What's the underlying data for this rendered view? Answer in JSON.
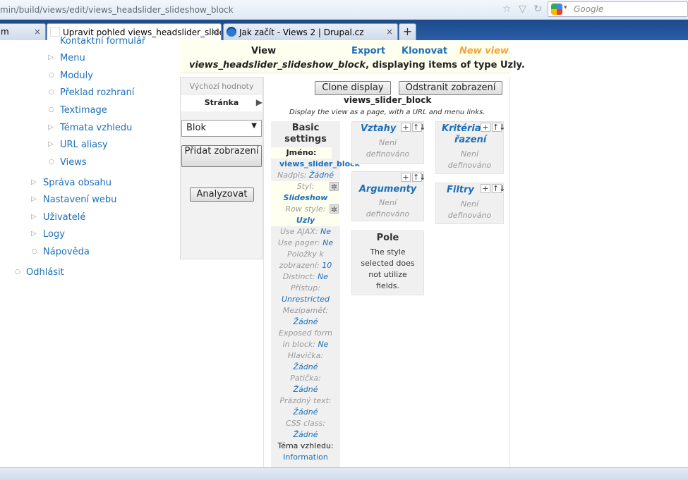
{
  "browser": {
    "url": "min/build/views/edit/views_headslider_slideshow_block",
    "search_placeholder": "Google",
    "tabs": [
      {
        "label": "m",
        "close": "×"
      },
      {
        "label": "Upravit pohled views_headslider_slide...",
        "close": "×"
      },
      {
        "label": "Jak začít - Views 2 | Drupal.cz",
        "close": "×"
      }
    ],
    "new_tab": "+"
  },
  "nav": {
    "sub_items": [
      "Kontaktní formulář",
      "Menu",
      "Moduly",
      "Překlad rozhraní",
      "Textimage",
      "Témata vzhledu",
      "URL aliasy",
      "Views"
    ],
    "top_items": [
      "Správa obsahu",
      "Nastavení webu",
      "Uživatelé",
      "Logy",
      "Nápověda"
    ],
    "logout": "Odhlásit"
  },
  "header": {
    "view_label": "View",
    "export": "Export",
    "clone": "Klonovat",
    "new_view": "New view",
    "view_name": "views_headslider_slideshow_block",
    "desc_suffix": ", displaying items of type Uzly."
  },
  "left": {
    "default_values": "Výchozí hodnoty",
    "active_tab": "Stránka",
    "select_value": "Blok",
    "add_display": "Přidat zobrazení",
    "analyze": "Analyzovat"
  },
  "display": {
    "clone_button": "Clone display",
    "remove_button": "Odstranit zobrazení",
    "name": "views_slider_block",
    "description": "Display the view as a page, with a URL and menu links."
  },
  "basic": {
    "heading": "Basic settings",
    "name_label": "Jméno:",
    "name_value": "views_slider_block",
    "title_label": "Nadpis:",
    "title_value": "Žádné",
    "style_label": "Styl:",
    "style_value": "Slideshow",
    "row_label": "Row style:",
    "row_value": "Uzly",
    "ajax_label": "Use AJAX:",
    "ajax_value": "Ne",
    "pager_label": "Use pager:",
    "pager_value": "Ne",
    "items_label_1": "Položky k",
    "items_label_2": "zobrazení:",
    "items_value": "10",
    "distinct_label": "Distinct:",
    "distinct_value": "Ne",
    "access_label": "Přístup:",
    "access_value": "Unrestricted",
    "cache_label": "Mezipaměť:",
    "cache_value": "Žádné",
    "exposed_label_1": "Exposed form",
    "exposed_label_2": "in block:",
    "exposed_value": "Ne",
    "header_label": "Hlavička:",
    "header_value": "Žádné",
    "footer_label": "Patička:",
    "footer_value": "Žádné",
    "empty_label": "Prázdný text:",
    "empty_value": "Žádné",
    "css_label": "CSS class:",
    "css_value": "Žádné",
    "theme_label": "Téma vzhledu:",
    "theme_value": "Information"
  },
  "boxes": {
    "not_defined_1": "Není",
    "not_defined_2": "definováno",
    "relationships": "Vztahy",
    "arguments": "Argumenty",
    "fields": "Pole",
    "fields_text": [
      "The style",
      "selected does",
      "not utilize",
      "fields."
    ],
    "sort_1": "Kritéria",
    "sort_2": "řazení",
    "filters": "Filtry",
    "plus": "+",
    "rearrange": "↑↓"
  }
}
